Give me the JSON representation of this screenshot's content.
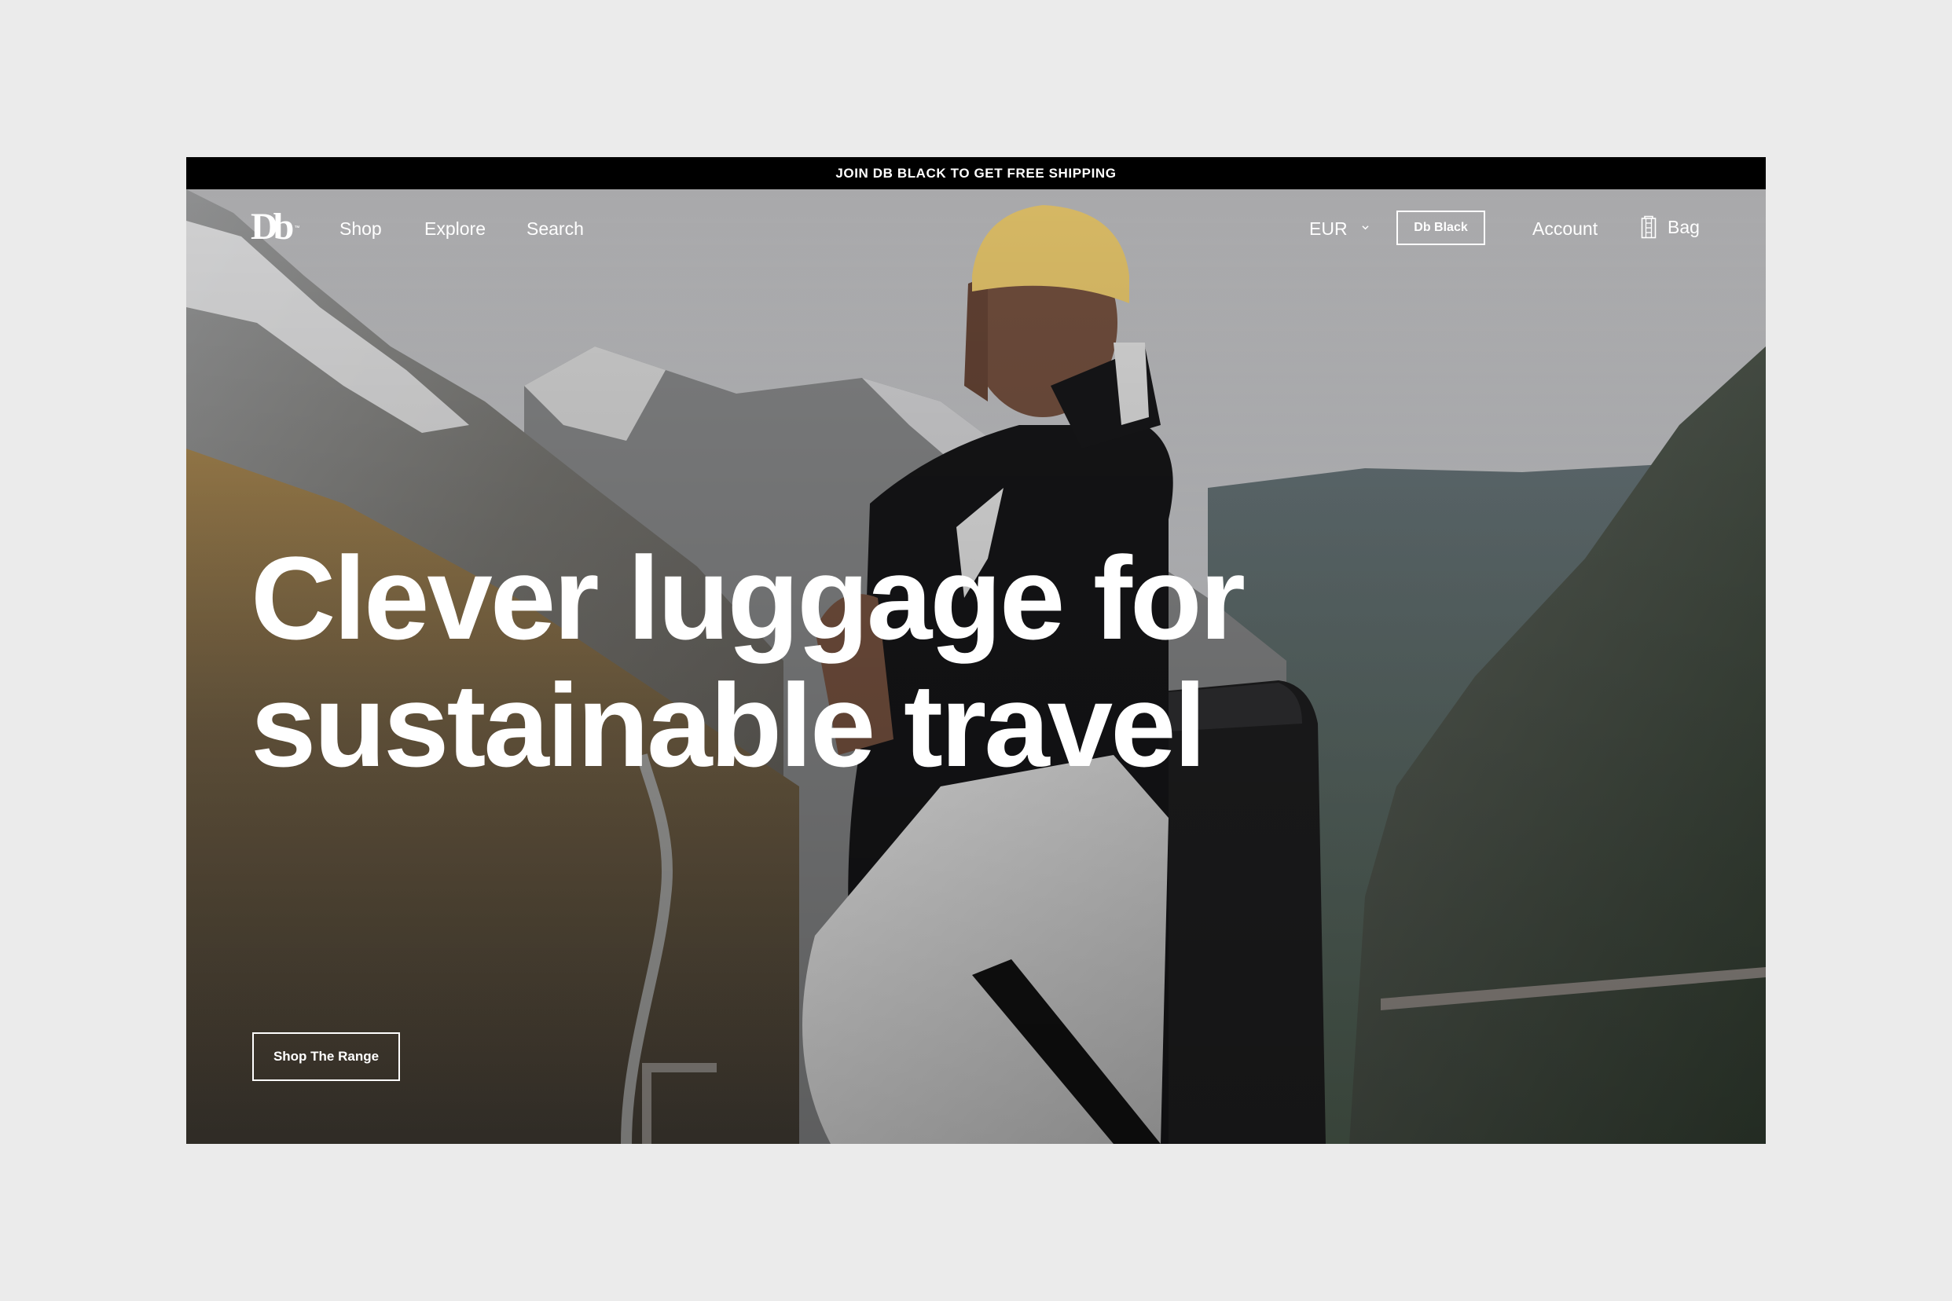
{
  "announcement": {
    "text": "JOIN DB BLACK TO GET FREE SHIPPING"
  },
  "nav": {
    "logo_text": "Db",
    "logo_mark": "™",
    "left_links": [
      {
        "label": "Shop"
      },
      {
        "label": "Explore"
      },
      {
        "label": "Search"
      }
    ],
    "currency": {
      "selected": "EUR",
      "icon": "chevron-down-icon"
    },
    "membership_button": "Db Black",
    "account_label": "Account",
    "bag": {
      "label": "Bag",
      "icon": "bag-icon"
    }
  },
  "hero": {
    "headline_lines": [
      "Clever luggage for",
      "sustainable travel"
    ],
    "cta_label": "Shop The Range",
    "image_description": "Man in yellow beanie and black/white jacket wearing a black backpack overlooking a mountain valley"
  },
  "colors": {
    "page_background": "#ebebeb",
    "announcement_bar": "#000000",
    "text_on_hero": "#ffffff",
    "beanie": "#d8b862"
  }
}
